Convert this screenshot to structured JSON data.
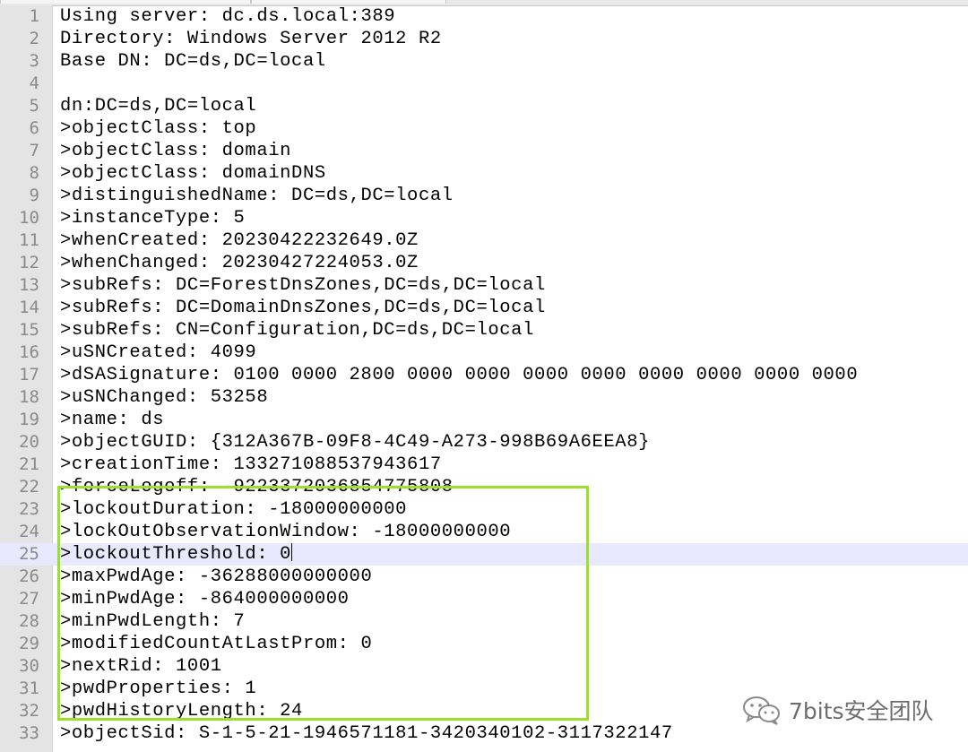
{
  "editor": {
    "lines": [
      {
        "num": "1",
        "text": "Using server: dc.ds.local:389"
      },
      {
        "num": "2",
        "text": "Directory: Windows Server 2012 R2"
      },
      {
        "num": "3",
        "text": "Base DN: DC=ds,DC=local"
      },
      {
        "num": "4",
        "text": ""
      },
      {
        "num": "5",
        "text": "dn:DC=ds,DC=local"
      },
      {
        "num": "6",
        "text": ">objectClass: top"
      },
      {
        "num": "7",
        "text": ">objectClass: domain"
      },
      {
        "num": "8",
        "text": ">objectClass: domainDNS"
      },
      {
        "num": "9",
        "text": ">distinguishedName: DC=ds,DC=local"
      },
      {
        "num": "10",
        "text": ">instanceType: 5"
      },
      {
        "num": "11",
        "text": ">whenCreated: 20230422232649.0Z"
      },
      {
        "num": "12",
        "text": ">whenChanged: 20230427224053.0Z"
      },
      {
        "num": "13",
        "text": ">subRefs: DC=ForestDnsZones,DC=ds,DC=local"
      },
      {
        "num": "14",
        "text": ">subRefs: DC=DomainDnsZones,DC=ds,DC=local"
      },
      {
        "num": "15",
        "text": ">subRefs: CN=Configuration,DC=ds,DC=local"
      },
      {
        "num": "16",
        "text": ">uSNCreated: 4099"
      },
      {
        "num": "17",
        "text": ">dSASignature: 0100 0000 2800 0000 0000 0000 0000 0000 0000 0000 0000"
      },
      {
        "num": "18",
        "text": ">uSNChanged: 53258"
      },
      {
        "num": "19",
        "text": ">name: ds"
      },
      {
        "num": "20",
        "text": ">objectGUID: {312A367B-09F8-4C49-A273-998B69A6EEA8}"
      },
      {
        "num": "21",
        "text": ">creationTime: 133271088537943617"
      },
      {
        "num": "22",
        "text": ">forceLogoff: -9223372036854775808"
      },
      {
        "num": "23",
        "text": ">lockoutDuration: -18000000000"
      },
      {
        "num": "24",
        "text": ">lockOutObservationWindow: -18000000000"
      },
      {
        "num": "25",
        "text": ">lockoutThreshold: 0"
      },
      {
        "num": "26",
        "text": ">maxPwdAge: -36288000000000"
      },
      {
        "num": "27",
        "text": ">minPwdAge: -864000000000"
      },
      {
        "num": "28",
        "text": ">minPwdLength: 7"
      },
      {
        "num": "29",
        "text": ">modifiedCountAtLastProm: 0"
      },
      {
        "num": "30",
        "text": ">nextRid: 1001"
      },
      {
        "num": "31",
        "text": ">pwdProperties: 1"
      },
      {
        "num": "32",
        "text": ">pwdHistoryLength: 24"
      },
      {
        "num": "33",
        "text": ">objectSid: S-1-5-21-1946571181-3420340102-3117322147"
      }
    ],
    "current_line": "25"
  },
  "highlight": {
    "color": "#9be02a"
  },
  "watermark": {
    "text": "7bits安全团队",
    "icon": "wechat-icon"
  }
}
